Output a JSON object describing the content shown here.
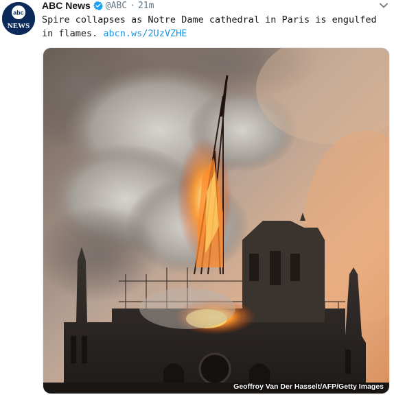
{
  "tweet": {
    "author_name": "ABC News",
    "handle": "@ABC",
    "separator": "·",
    "time": "21m",
    "text": "Spire collapses as Notre Dame cathedral in Paris is engulfed in flames.",
    "link": "abcn.ws/2UzVZHE",
    "photo_credit": "Geoffroy Van Der Hasselt/AFP/Getty Images"
  },
  "avatar": {
    "logo_text_top": "abc",
    "logo_text_bottom": "NEWS"
  },
  "colors": {
    "link": "#1b95e0",
    "verified": "#1da1f2",
    "text": "#14171a",
    "muted": "#657786"
  },
  "icons": {
    "verified": "verified-badge-icon",
    "menu": "chevron-down-icon"
  }
}
